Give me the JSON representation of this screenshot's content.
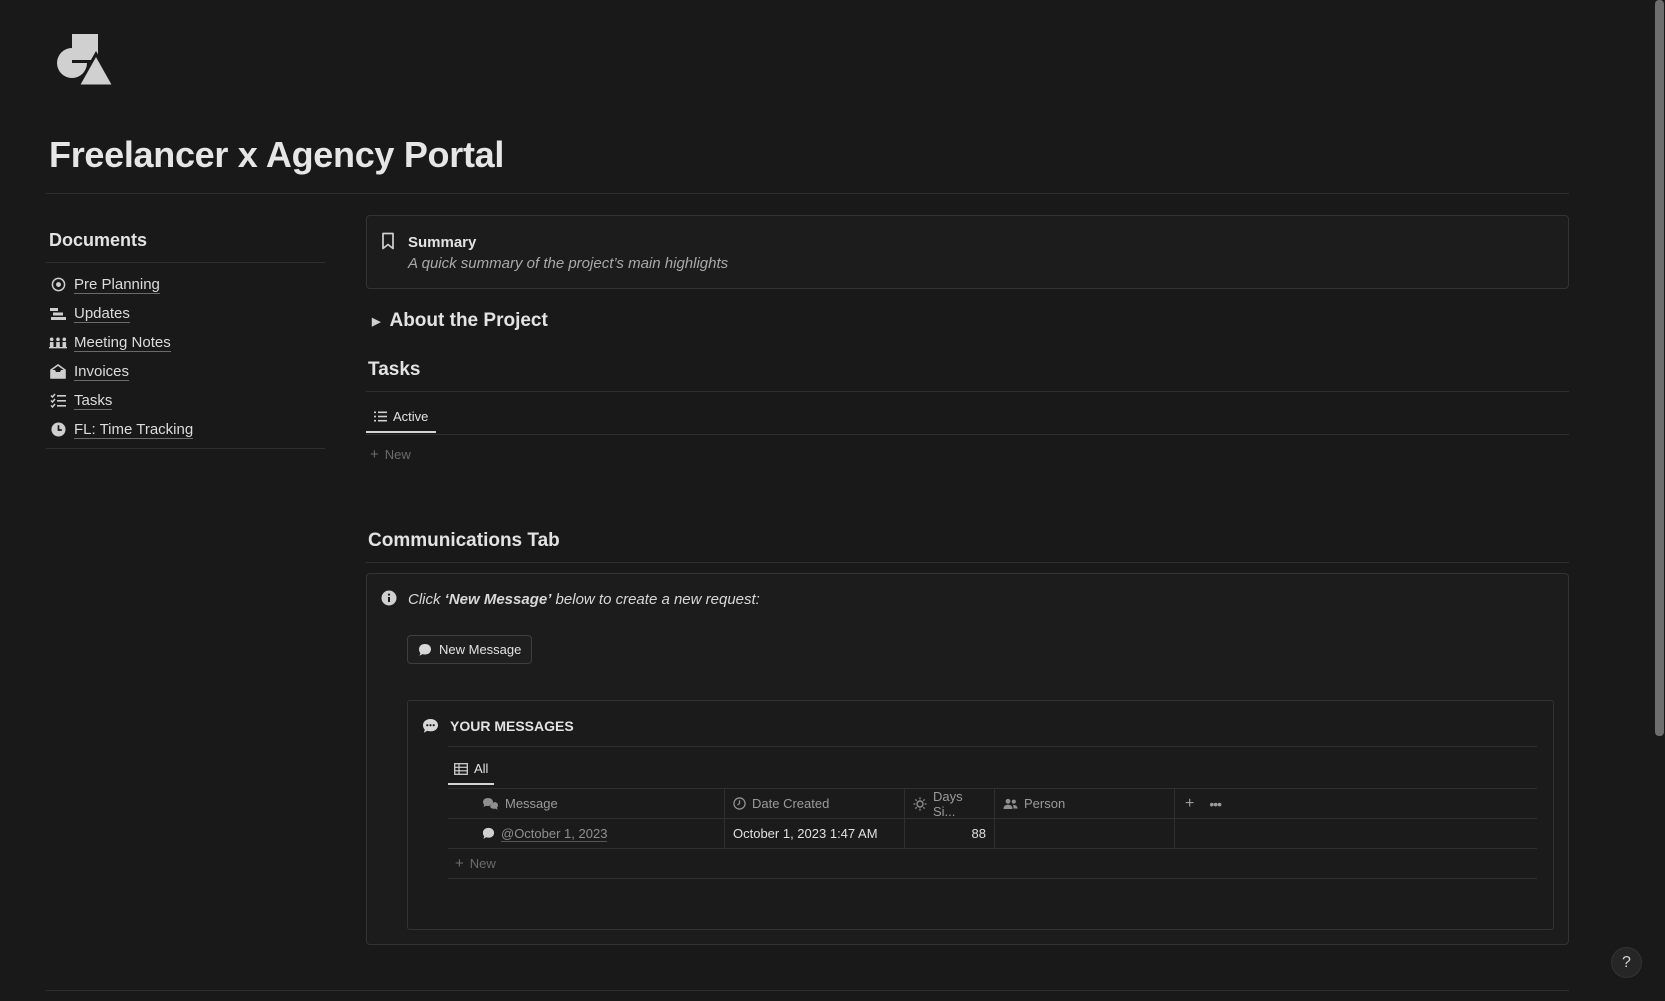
{
  "page": {
    "title": "Freelancer x Agency Portal",
    "icon": "shapes-icon"
  },
  "sidebar": {
    "heading": "Documents",
    "items": [
      {
        "label": "Pre Planning",
        "icon": "target-icon"
      },
      {
        "label": "Updates",
        "icon": "timeline-icon"
      },
      {
        "label": "Meeting Notes",
        "icon": "group-icon"
      },
      {
        "label": "Invoices",
        "icon": "inbox-icon"
      },
      {
        "label": "Tasks",
        "icon": "checklist-icon"
      },
      {
        "label": "FL: Time Tracking",
        "icon": "clock-icon"
      }
    ]
  },
  "summary": {
    "title": "Summary",
    "subtitle": "A quick summary of the project’s main highlights",
    "icon": "bookmark-icon"
  },
  "about": {
    "label": "About the Project"
  },
  "tasks": {
    "heading": "Tasks",
    "tab": "Active",
    "new_label": "New"
  },
  "communications": {
    "heading": "Communications Tab",
    "instruction_prefix": "Click ",
    "instruction_bold": "‘New Message’",
    "instruction_suffix": " below to create a new request:",
    "button_label": "New Message",
    "messages": {
      "heading": "YOUR MESSAGES",
      "tab": "All",
      "columns": [
        "Message",
        "Date Created",
        "Days Si...",
        "Person"
      ],
      "rows": [
        {
          "message": "@October 1, 2023",
          "date_created": "October 1, 2023 1:47 AM",
          "days_since": "88",
          "person": ""
        }
      ],
      "new_label": "New"
    }
  },
  "help": {
    "label": "?"
  },
  "colors": {
    "background": "#191919",
    "text": "#d4d4d4",
    "muted": "#9b9b9b",
    "border": "#2f2f2f"
  }
}
